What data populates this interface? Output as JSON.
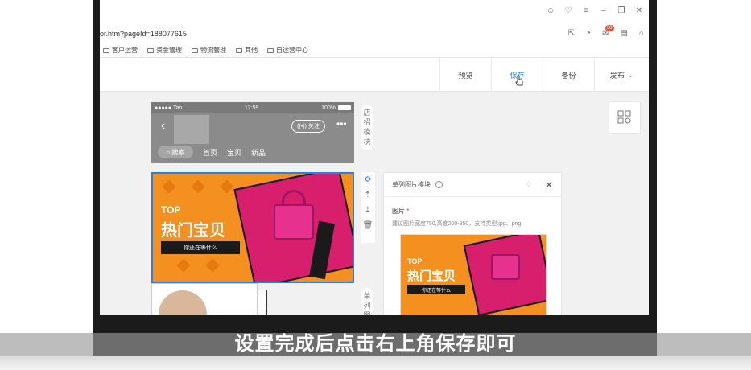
{
  "browser": {
    "url": "or.htm?pageId=188077615",
    "mail_badge": "30",
    "bookmarks": [
      "客户运营",
      "资金管理",
      "物流管理",
      "其他",
      "自运营中心"
    ]
  },
  "toolbar": {
    "preview_label": "预览",
    "save_label": "保存",
    "backup_label": "备份",
    "publish_label": "发布"
  },
  "shop_header": {
    "carrier": "●●●●● Tao",
    "time": "12:59",
    "battery": "100%",
    "follow_label": "关注",
    "nav": [
      "搜索",
      "首页",
      "宝贝",
      "新品"
    ],
    "side_label": "店招模块"
  },
  "banner": {
    "top_text": "TOP",
    "title": "热门宝贝",
    "subtitle": "你还在等什么"
  },
  "second_module_label": "单列图",
  "panel": {
    "title": "单列图片模块",
    "image_label": "图片",
    "required_mark": "*",
    "hint": "建议图片宽度750,高度200-950，支持类型:jpg、png",
    "thumb_top": "TOP",
    "thumb_title": "热门宝贝",
    "thumb_sub": "你还在等什么"
  },
  "caption": "设置完成后点击右上角保存即可"
}
